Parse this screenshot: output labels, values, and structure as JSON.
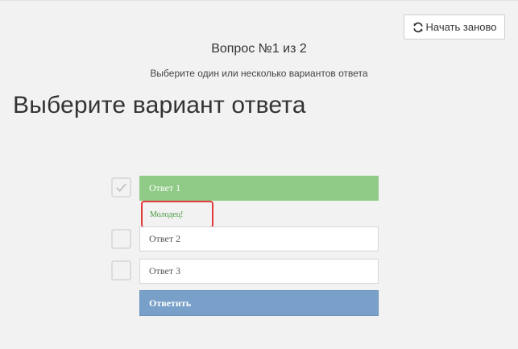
{
  "header": {
    "restart_label": "Начать заново",
    "restart_icon": "refresh-icon"
  },
  "question": {
    "counter": "Вопрос №1 из 2",
    "hint": "Выберите один или несколько вариантов ответа",
    "title": "Выберите вариант ответа"
  },
  "options": [
    {
      "label": "Ответ 1",
      "checked": true,
      "correct": true
    },
    {
      "label": "Ответ 2",
      "checked": false
    },
    {
      "label": "Ответ 3",
      "checked": false
    }
  ],
  "feedback": {
    "text": "Молодец!"
  },
  "submit": {
    "label": "Ответить"
  },
  "colors": {
    "correct": "#8fcb86",
    "submit": "#79a0c9",
    "feedback_text": "#4a9a3f",
    "highlight_border": "#e23b3b"
  }
}
